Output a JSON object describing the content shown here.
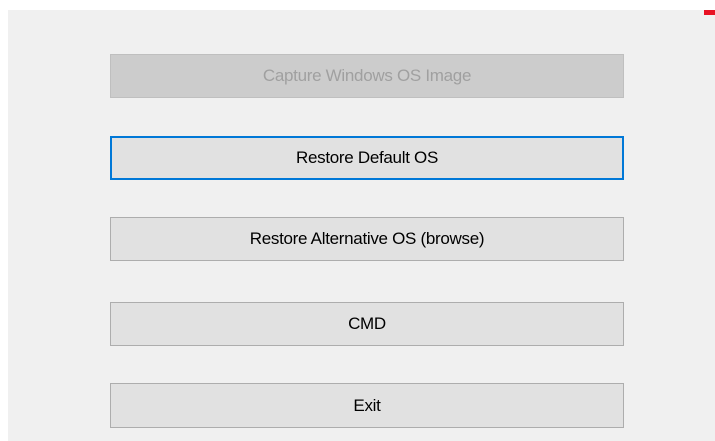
{
  "buttons": {
    "capture": "Capture Windows OS Image",
    "restore_default": "Restore Default OS",
    "restore_alternative": "Restore Alternative OS (browse)",
    "cmd": "CMD",
    "exit": "Exit"
  },
  "colors": {
    "window_bg": "#f0f0f0",
    "button_bg": "#e1e1e1",
    "disabled_bg": "#cccccc",
    "disabled_text": "#a0a0a0",
    "focus_border": "#0078d7",
    "close_accent": "#e81123"
  },
  "state": {
    "capture_enabled": false,
    "focused_button": "restore_default"
  }
}
